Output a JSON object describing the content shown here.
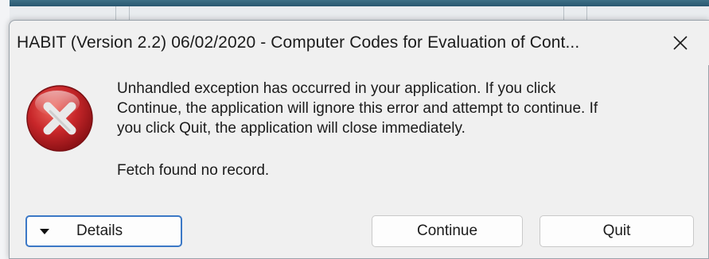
{
  "dialog": {
    "title": "HABIT  (Version 2.2) 06/02/2020 - Computer Codes for Evaluation of Cont...",
    "close_icon": "close-icon",
    "error_icon": "error-icon",
    "message": [
      "Unhandled exception has occurred in your application. If you click",
      "Continue, the application will ignore this error and attempt to continue. If",
      "you click Quit, the application will close immediately."
    ],
    "detail": "Fetch found no record.",
    "buttons": {
      "details": "Details",
      "continue": "Continue",
      "quit": "Quit"
    }
  },
  "colors": {
    "dialog_background": "#f0f0f0",
    "focus_border": "#3b78c6",
    "error_red": "#c8272a"
  }
}
